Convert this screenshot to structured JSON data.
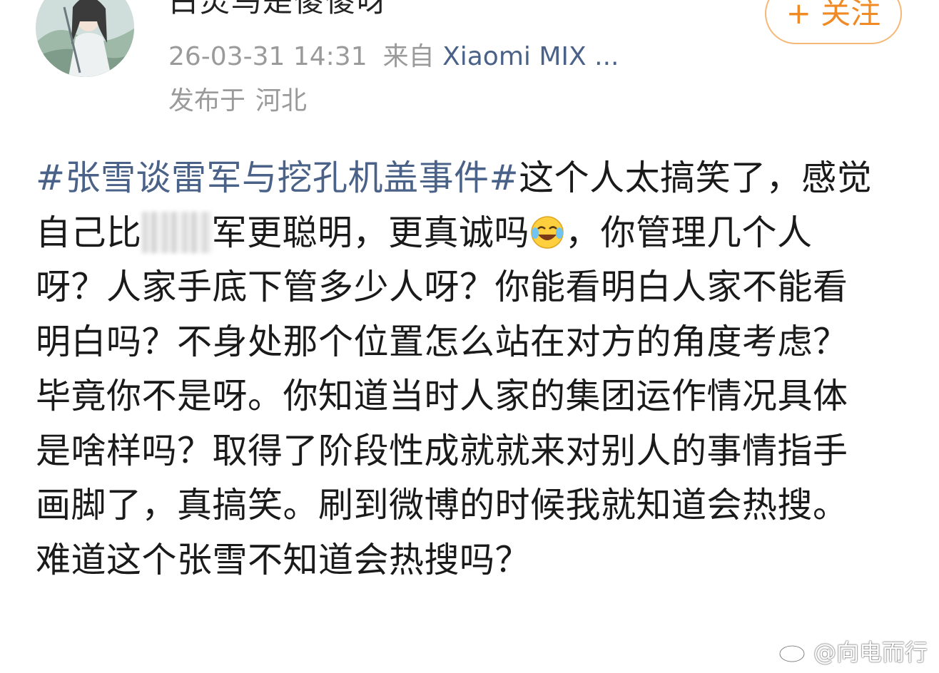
{
  "post": {
    "username": "白灵鸟是傻傻呀",
    "follow_label": "+ 关注",
    "timestamp": "26-03-31 14:31",
    "source_prefix": "来自",
    "source_device": "Xiaomi MIX ...",
    "location_prefix": "发布于",
    "location": "河北",
    "hashtag": "#张雪谈雷军与挖孔机盖事件#",
    "text_1": "这个人太搞笑了，感觉自己比",
    "text_2": "军更聪明，更真诚吗",
    "text_3": "，你管理几个人呀？人家手底下管多少人呀？你能看明白人家不能看明白吗？不身处那个位置怎么站在对方的角度考虑？毕竟你不是呀。你知道当时人家的集团运作情况具体是啥样吗？取得了阶段性成就就来对别人的事情指手画脚了，真搞笑。刷到微博的时候我就知道会热搜。难道这个张雪不知道会热搜吗？",
    "emoji_name": "laughing-crying-emoji"
  },
  "watermark": {
    "text": "@向电而行",
    "icon": "weibo-logo-icon"
  },
  "colors": {
    "hashtag": "#4a6188",
    "follow": "#f08a24",
    "meta": "#9a9a9a"
  }
}
